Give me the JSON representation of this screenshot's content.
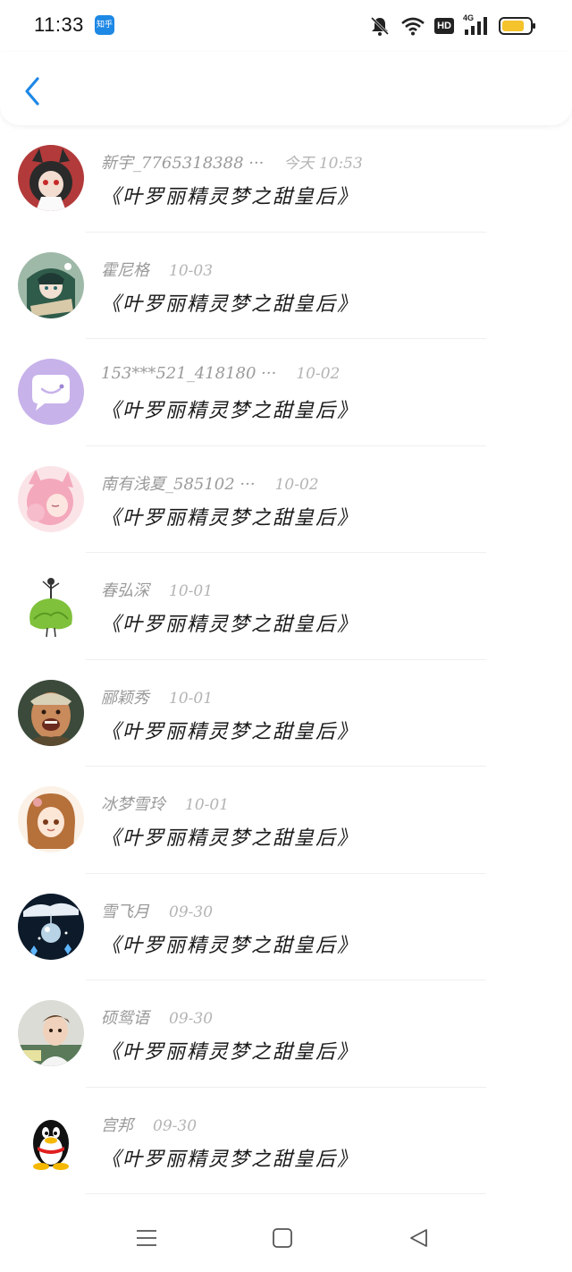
{
  "status_bar": {
    "time": "11:33",
    "app_badge": "知乎",
    "hd_label": "HD",
    "network_label": "4G",
    "battery_color": "#f5c32c"
  },
  "header": {
    "back_icon": "chevron-left-icon",
    "accent_color": "#1e88e5"
  },
  "messages": [
    {
      "name": "新宇_7765318388 ···",
      "time": "今天 10:53",
      "text": "《叶罗丽精灵梦之甜皇后》",
      "avatar": "anime-girl-black-hair"
    },
    {
      "name": "霍尼格",
      "time": "10-03",
      "text": "《叶罗丽精灵梦之甜皇后》",
      "avatar": "anime-boy-green"
    },
    {
      "name": "153***521_418180 ···",
      "time": "10-02",
      "text": "《叶罗丽精灵梦之甜皇后》",
      "avatar": "default-chat-bubble"
    },
    {
      "name": "南有浅夏_585102 ···",
      "time": "10-02",
      "text": "《叶罗丽精灵梦之甜皇后》",
      "avatar": "pink-hair-girl"
    },
    {
      "name": "春弘深",
      "time": "10-01",
      "text": "《叶罗丽精灵梦之甜皇后》",
      "avatar": "lettuce-dress-figure"
    },
    {
      "name": "郦颖秀",
      "time": "10-01",
      "text": "《叶罗丽精灵梦之甜皇后》",
      "avatar": "laughing-man-photo"
    },
    {
      "name": "冰梦雪玲",
      "time": "10-01",
      "text": "《叶罗丽精灵梦之甜皇后》",
      "avatar": "brown-hair-anime-girl"
    },
    {
      "name": "雪飞月",
      "time": "09-30",
      "text": "《叶罗丽精灵梦之甜皇后》",
      "avatar": "snow-ornament"
    },
    {
      "name": "硕鸳语",
      "time": "09-30",
      "text": "《叶罗丽精灵梦之甜皇后》",
      "avatar": "young-man-photo"
    },
    {
      "name": "宫邦",
      "time": "09-30",
      "text": "《叶罗丽精灵梦之甜皇后》",
      "avatar": "qq-penguin"
    }
  ],
  "bottom_nav": {
    "menu_icon": "menu-icon",
    "home_icon": "square-home-icon",
    "back_icon": "triangle-back-icon"
  }
}
